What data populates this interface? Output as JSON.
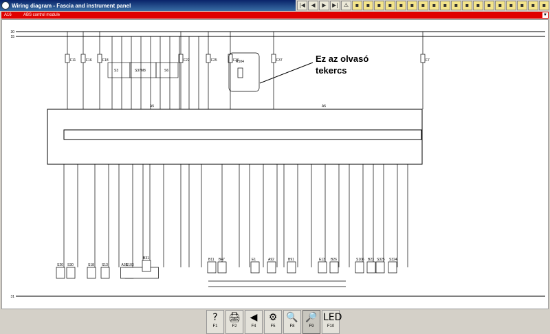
{
  "window": {
    "title": "Wiring diagram - Fascia and instrument panel"
  },
  "toolbar": {
    "icons": [
      "first-icon",
      "prev-icon",
      "next-icon",
      "last-icon",
      "warning-icon",
      "tool-icon",
      "tool-icon",
      "tool-icon",
      "tool-icon",
      "tool-icon",
      "tool-icon",
      "tool-icon",
      "tool-icon",
      "tool-icon",
      "tool-icon",
      "tool-icon",
      "tool-icon",
      "tool-icon",
      "tool-icon",
      "tool-icon",
      "tool-icon",
      "tool-icon",
      "tool-icon"
    ]
  },
  "header": {
    "code": "A16",
    "module": "ABS control module"
  },
  "annotation": {
    "line1": "Ez az olvasó",
    "line2": "tekercs"
  },
  "diagram": {
    "fuses": [
      "F11",
      "F16",
      "F18",
      "F22",
      "F25",
      "F36",
      "F37",
      "F7"
    ],
    "relay_label": "R104",
    "main_unit": "A5",
    "connectors": [
      "S20",
      "S30",
      "S18",
      "S13",
      "S103",
      "A35",
      "B31",
      "B11",
      "B47",
      "E1",
      "A92",
      "B91",
      "E13",
      "B26",
      "S106",
      "B23",
      "S325",
      "S324"
    ],
    "rails": [
      "30",
      "15",
      "31"
    ]
  },
  "fkeys": [
    {
      "icon": "?",
      "label": "F1"
    },
    {
      "icon": "🖨",
      "label": "F2"
    },
    {
      "icon": "◀",
      "label": "F4"
    },
    {
      "icon": "⚙",
      "label": "F5"
    },
    {
      "icon": "🔍",
      "label": "F8"
    },
    {
      "icon": "🔎",
      "label": "F9"
    },
    {
      "icon": "LED",
      "label": "F10"
    }
  ]
}
